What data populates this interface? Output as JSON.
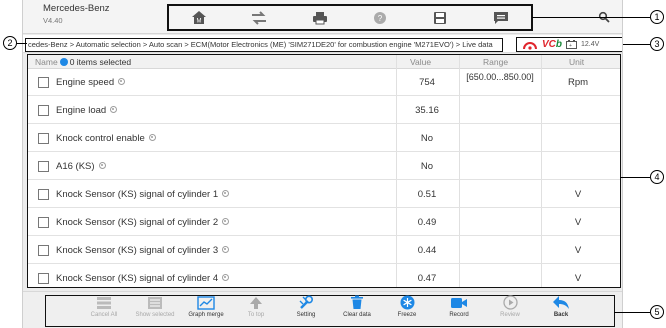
{
  "app": {
    "title": "Mercedes-Benz",
    "version": "V4.40"
  },
  "breadcrumb": "cedes-Benz > Automatic selection > Auto scan > ECM(Motor Electronics (ME) 'SIM271DE20' for combustion engine 'M271EVO') > Live data",
  "status": {
    "vci_label": "VC",
    "vci_suffix": "b",
    "voltage": "12.4V"
  },
  "table": {
    "headers": {
      "name": "Name",
      "selected": "0 items selected",
      "value": "Value",
      "range": "Range",
      "unit": "Unit"
    },
    "rows": [
      {
        "name": "Engine speed",
        "value": "754",
        "range": "[650.00...850.00]",
        "unit": "Rpm"
      },
      {
        "name": "Engine load",
        "value": "35.16",
        "range": "",
        "unit": ""
      },
      {
        "name": "Knock control enable",
        "value": "No",
        "range": "",
        "unit": ""
      },
      {
        "name": "A16 (KS)",
        "value": "No",
        "range": "",
        "unit": ""
      },
      {
        "name": "Knock Sensor (KS) signal of cylinder 1",
        "value": "0.51",
        "range": "",
        "unit": "V"
      },
      {
        "name": "Knock Sensor (KS) signal of cylinder 2",
        "value": "0.49",
        "range": "",
        "unit": "V"
      },
      {
        "name": "Knock Sensor (KS) signal of cylinder 3",
        "value": "0.44",
        "range": "",
        "unit": "V"
      },
      {
        "name": "Knock Sensor (KS) signal of cylinder 4",
        "value": "0.47",
        "range": "",
        "unit": "V"
      }
    ]
  },
  "bottom_toolbar": {
    "cancel_all": "Cancel All",
    "show_selected": "Show selected",
    "graph_merge": "Graph merge",
    "to_top": "To top",
    "setting": "Setting",
    "clear_data": "Clear data",
    "freeze": "Freeze",
    "record": "Record",
    "review": "Review",
    "back": "Back"
  },
  "callouts": [
    "1",
    "2",
    "3",
    "4",
    "5"
  ],
  "colors": {
    "accent_blue": "#1e88e5",
    "vci_red": "#e0262d",
    "vci_green": "#1c8a3c"
  }
}
